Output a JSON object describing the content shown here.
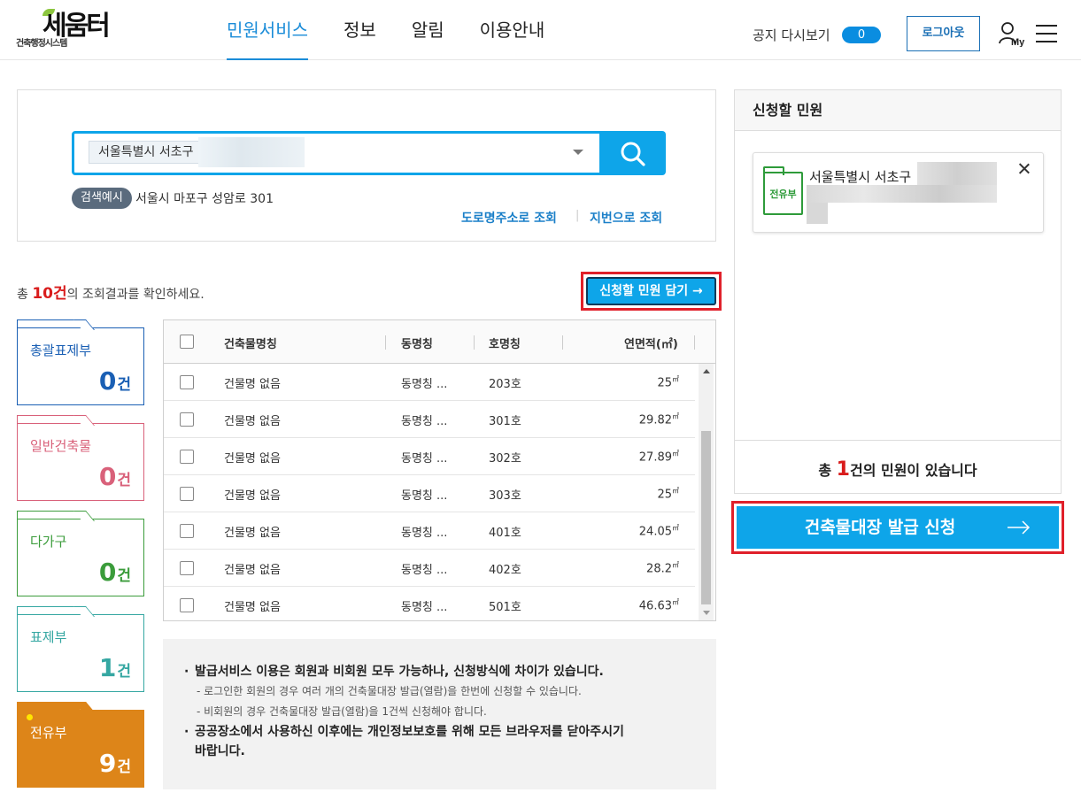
{
  "header": {
    "logo_sub": "건축행정시스템",
    "logo_main": "세움터",
    "nav": [
      "민원서비스",
      "정보",
      "알림",
      "이용안내"
    ],
    "notice_again": "공지 다시보기",
    "notice_toggle_value": "0",
    "logout": "로그아웃",
    "my_label": "My"
  },
  "search": {
    "selected_address": "서울특별시 서초구",
    "example_tag": "검색예시",
    "example_text": "서울시 마포구 성암로 301",
    "link_road": "도로명주소로 조회",
    "link_sep": "|",
    "link_jibun": "지번으로 조회"
  },
  "results": {
    "prefix": "총 ",
    "count": "10건",
    "suffix": "의 조회결과를 확인하세요.",
    "add_button": "신청할 민원 담기 →"
  },
  "categories": [
    {
      "label": "총괄표제부",
      "num": "0",
      "unit": "건"
    },
    {
      "label": "일반건축물",
      "num": "0",
      "unit": "건"
    },
    {
      "label": "다가구",
      "num": "0",
      "unit": "건"
    },
    {
      "label": "표제부",
      "num": "1",
      "unit": "건"
    },
    {
      "label": "전유부",
      "num": "9",
      "unit": "건"
    }
  ],
  "table": {
    "headers": [
      "건축물명칭",
      "동명칭",
      "호명칭",
      "연면적(㎡)"
    ],
    "rows": [
      {
        "name": "건물명 없음",
        "dong": "동명칭 ...",
        "ho": "203호",
        "area": "25",
        "unit": "㎡"
      },
      {
        "name": "건물명 없음",
        "dong": "동명칭 ...",
        "ho": "301호",
        "area": "29.82",
        "unit": "㎡"
      },
      {
        "name": "건물명 없음",
        "dong": "동명칭 ...",
        "ho": "302호",
        "area": "27.89",
        "unit": "㎡"
      },
      {
        "name": "건물명 없음",
        "dong": "동명칭 ...",
        "ho": "303호",
        "area": "25",
        "unit": "㎡"
      },
      {
        "name": "건물명 없음",
        "dong": "동명칭 ...",
        "ho": "401호",
        "area": "24.05",
        "unit": "㎡"
      },
      {
        "name": "건물명 없음",
        "dong": "동명칭 ...",
        "ho": "402호",
        "area": "28.2",
        "unit": "㎡"
      },
      {
        "name": "건물명 없음",
        "dong": "동명칭 ...",
        "ho": "501호",
        "area": "46.63",
        "unit": "㎡"
      }
    ]
  },
  "info": {
    "line1": "발급서비스 이용은 회원과 비회원 모두 가능하나, 신청방식에 차이가 있습니다.",
    "sub1": "- 로그인한 회원의 경우 여러 개의 건축물대장 발급(열람)을 한번에 신청할 수 있습니다.",
    "sub2": "- 비회원의 경우 건축물대장 발급(열람)을 1건씩 신청해야 합니다.",
    "line2a": "공공장소에서 사용하신 이후에는 개인정보보호를 위해 모든 브라우저를 닫아주시기",
    "line2b": "바랍니다."
  },
  "apply": {
    "title": "신청할 민원",
    "doc_label": "전유부",
    "card_address": "서울특별시 서초구",
    "footer_prefix": "총 ",
    "footer_count": "1",
    "footer_suffix": "건의 민원이 있습니다",
    "issue_button": "건축물대장 발급 신청"
  },
  "colors": {
    "accent": "#0ea5e9",
    "highlight_border": "#e0202a",
    "count_red": "#d91c1c"
  }
}
